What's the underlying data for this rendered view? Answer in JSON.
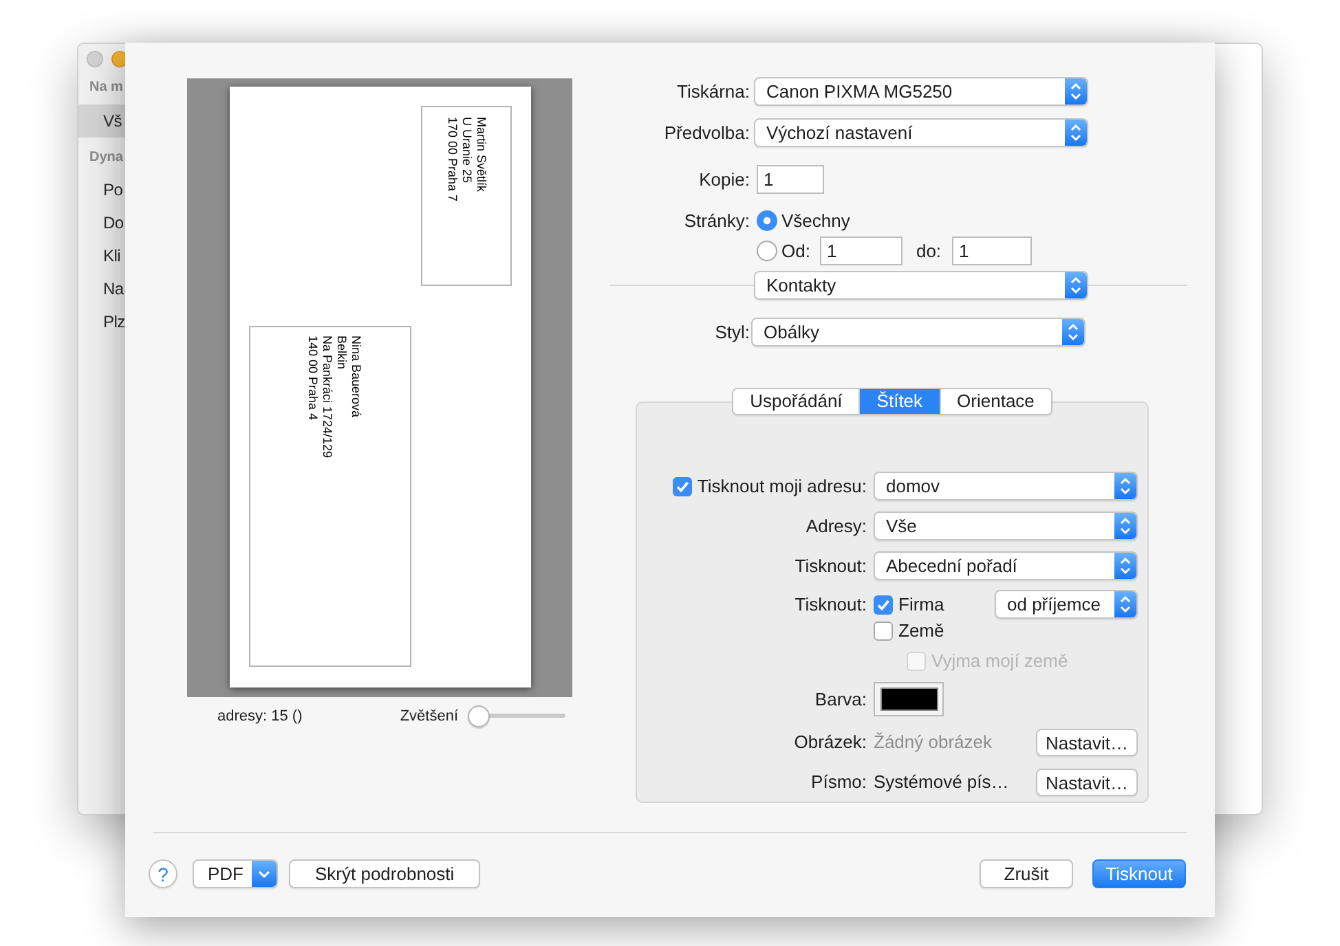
{
  "background_window": {
    "sidebar": [
      {
        "heading": "Na m",
        "items": [
          {
            "label": "Vš",
            "selected": true
          }
        ]
      },
      {
        "heading": "Dyna",
        "items": [
          {
            "label": "Po",
            "selected": false
          },
          {
            "label": "Do",
            "selected": false
          },
          {
            "label": "Kli",
            "selected": false
          },
          {
            "label": "Na",
            "selected": false
          },
          {
            "label": "Plz",
            "selected": false
          }
        ]
      }
    ]
  },
  "preview": {
    "sender": [
      "Martin Světlík",
      "U Uranie 25",
      "170 00 Praha 7"
    ],
    "recipient": [
      "Nina Bauerová",
      "Belkin",
      "Na Pankráci 1724/129",
      "140 00 Praha 4"
    ],
    "count": "adresy: 15 ()",
    "zoom": {
      "label": "Zvětšení",
      "level": 0
    }
  },
  "settings": {
    "printer": {
      "label": "Tiskárna:",
      "value": "Canon PIXMA MG5250"
    },
    "preset": {
      "label": "Předvolba:",
      "value": "Výchozí nastavení"
    },
    "copies": {
      "label": "Kopie:",
      "value": "1"
    },
    "pages": {
      "label": "Stránky:",
      "options": [
        {
          "kind": "all",
          "label": "Všechny",
          "selected": true
        },
        {
          "kind": "range",
          "label": "Od:",
          "selected": false,
          "from": "1",
          "to_label": "do:",
          "to": "1"
        }
      ]
    },
    "app_menu": {
      "value": "Kontakty"
    },
    "style": {
      "label": "Styl:",
      "value": "Obálky"
    }
  },
  "tabs": [
    {
      "label": "Uspořádání",
      "selected": false
    },
    {
      "label": "Štítek",
      "selected": true
    },
    {
      "label": "Orientace",
      "selected": false
    }
  ],
  "label_tab": {
    "rows": [
      {
        "kind": "checkbox_popup",
        "label": "Tisknout moji adresu:",
        "checked": true,
        "value": "domov"
      },
      {
        "kind": "popup",
        "label": "Adresy:",
        "value": "Vše"
      },
      {
        "kind": "popup",
        "label": "Tisknout:",
        "value": "Abecední pořadí"
      },
      {
        "kind": "checkboxes",
        "label": "Tisknout:",
        "options": [
          {
            "label": "Firma",
            "checked": true
          },
          {
            "label": "Země",
            "checked": false,
            "children": [
              {
                "label": "Vyjma mojí země",
                "checked": false,
                "disabled": true
              }
            ]
          }
        ],
        "value": "od příjemce"
      },
      {
        "kind": "color",
        "label": "Barva:",
        "color": "#000000"
      },
      {
        "kind": "setting",
        "label": "Obrázek:",
        "value": "Žádný obrázek",
        "muted": true,
        "button": "Nastavit…"
      },
      {
        "kind": "setting",
        "label": "Písmo:",
        "value": "Systémové pís…",
        "muted": false,
        "button": "Nastavit…"
      }
    ]
  },
  "footer": {
    "help": "?",
    "pdf": "PDF",
    "details_button": "Skrýt podrobnosti",
    "buttons": [
      {
        "label": "Zrušit",
        "default": false
      },
      {
        "label": "Tisknout",
        "default": true
      }
    ]
  }
}
